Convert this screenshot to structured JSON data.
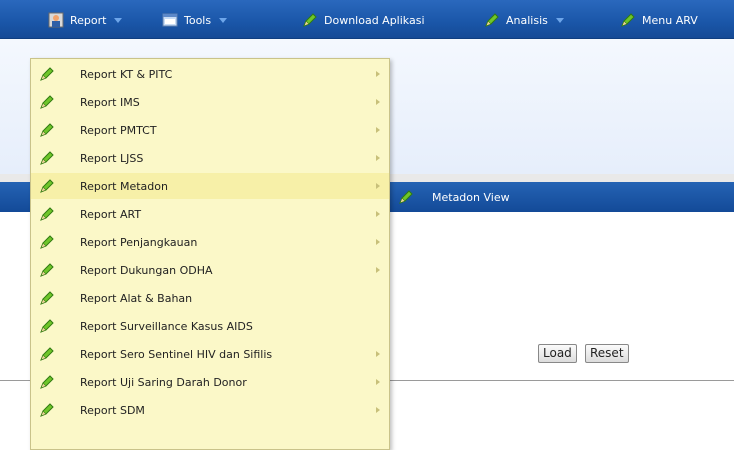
{
  "menubar": {
    "items": [
      {
        "label": "Report",
        "icon": "report-icon",
        "has_arrow": true
      },
      {
        "label": "Tools",
        "icon": "tools-icon",
        "has_arrow": true
      },
      {
        "label": "Download Aplikasi",
        "icon": "pencil-icon",
        "has_arrow": false
      },
      {
        "label": "Analisis",
        "icon": "pencil-icon",
        "has_arrow": true
      },
      {
        "label": "Menu ARV",
        "icon": "pencil-icon",
        "has_arrow": false
      }
    ]
  },
  "report_menu": {
    "items": [
      {
        "label": "Report KT & PITC",
        "has_submenu": true
      },
      {
        "label": "Report IMS",
        "has_submenu": true
      },
      {
        "label": "Report PMTCT",
        "has_submenu": true
      },
      {
        "label": "Report LJSS",
        "has_submenu": true
      },
      {
        "label": "Report Metadon",
        "has_submenu": true
      },
      {
        "label": "Report ART",
        "has_submenu": true
      },
      {
        "label": "Report Penjangkauan",
        "has_submenu": true
      },
      {
        "label": "Report Dukungan ODHA",
        "has_submenu": true
      },
      {
        "label": "Report Alat & Bahan",
        "has_submenu": false
      },
      {
        "label": "Report Surveillance Kasus AIDS",
        "has_submenu": false
      },
      {
        "label": "Report Sero Sentinel HIV dan Sifilis",
        "has_submenu": true
      },
      {
        "label": "Report Uji Saring Darah Donor",
        "has_submenu": true
      },
      {
        "label": "Report SDM",
        "has_submenu": true
      }
    ]
  },
  "submenu": {
    "metadon_view_label": "Metadon View"
  },
  "buttons": {
    "load_label": "Load",
    "reset_label": "Reset"
  },
  "colors": {
    "menubar": "#1a56a8",
    "dropdown_bg": "#fbf8c8",
    "pencil_green": "#4caf1e"
  }
}
